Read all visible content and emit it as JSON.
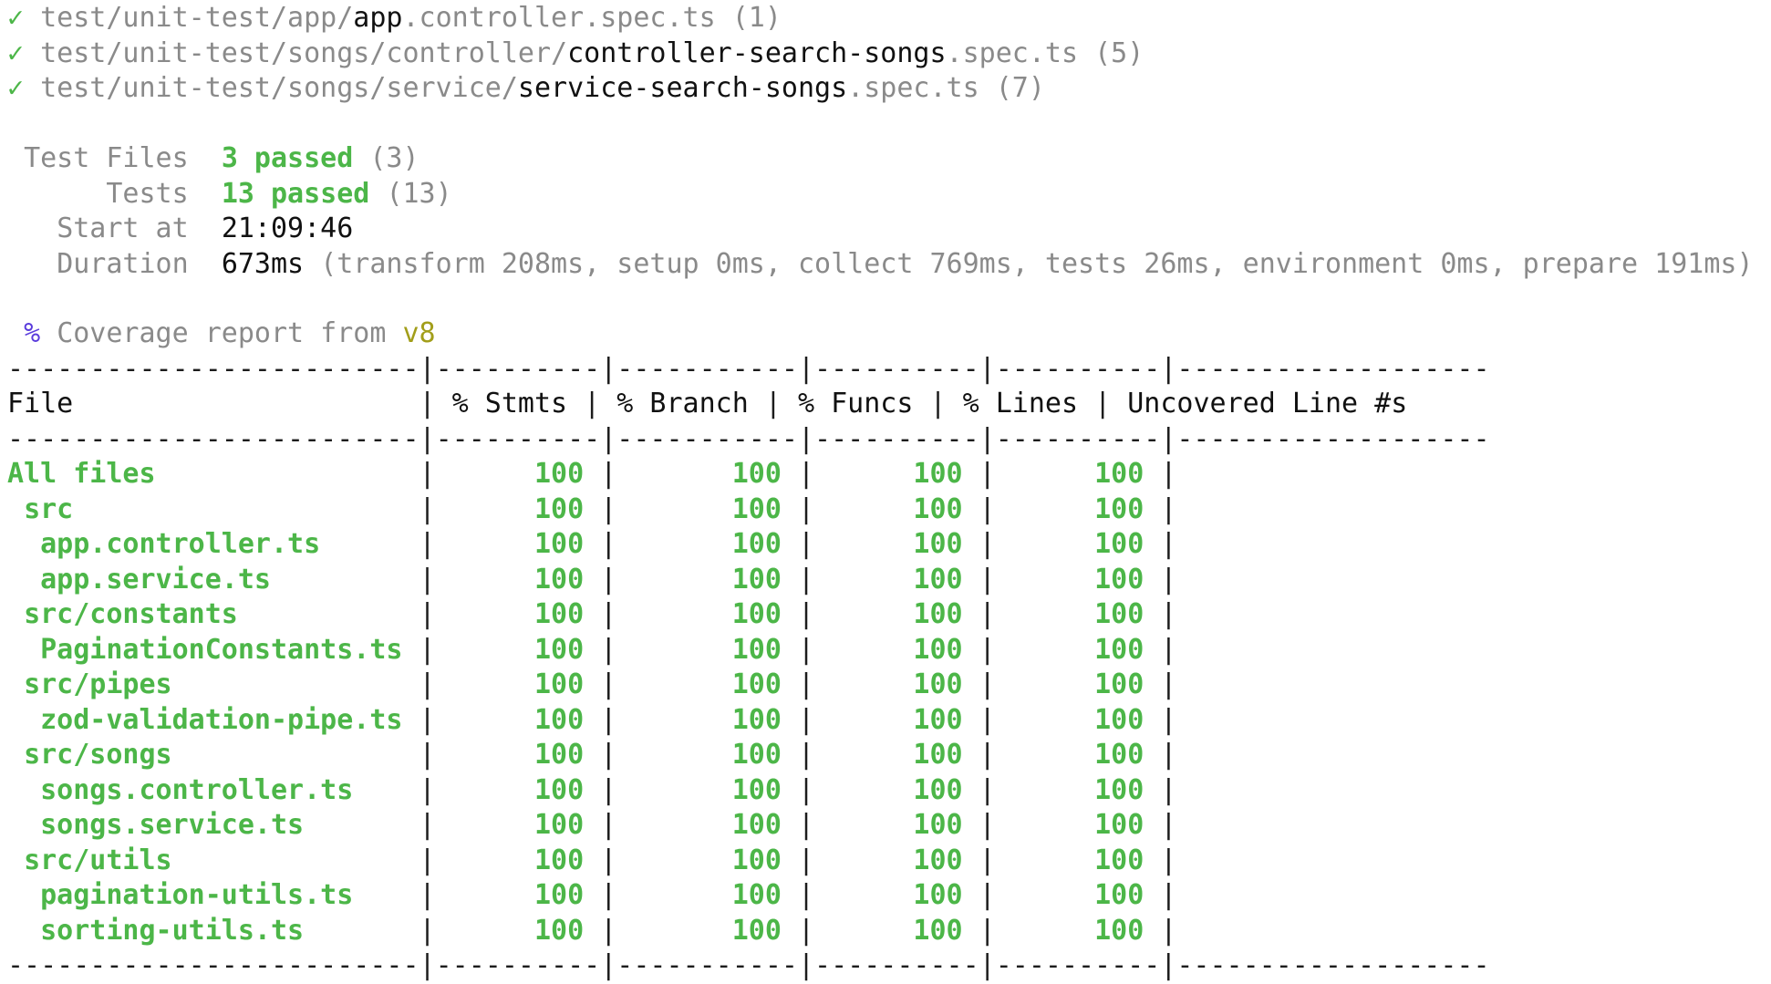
{
  "spec_files": [
    {
      "dir": "test/unit-test/app/",
      "name": "app",
      "ext": ".controller.spec.ts",
      "count": "(1)"
    },
    {
      "dir": "test/unit-test/songs/controller/",
      "name": "controller-search-songs",
      "ext": ".spec.ts",
      "count": "(5)"
    },
    {
      "dir": "test/unit-test/songs/service/",
      "name": "service-search-songs",
      "ext": ".spec.ts",
      "count": "(7)"
    }
  ],
  "summary": {
    "test_files": {
      "label": "Test Files",
      "passed": "3 passed",
      "total": "(3)"
    },
    "tests": {
      "label": "Tests",
      "passed": "13 passed",
      "total": "(13)"
    },
    "start_at": {
      "label": "Start at",
      "value": "21:09:46"
    },
    "duration": {
      "label": "Duration",
      "value": "673ms",
      "detail": "(transform 208ms, setup 0ms, collect 769ms, tests 26ms, environment 0ms, prepare 191ms)"
    }
  },
  "coverage": {
    "percent_sign": "%",
    "text": "Coverage report from",
    "provider": "v8"
  },
  "table": {
    "headers": [
      "File",
      "% Stmts",
      "% Branch",
      "% Funcs",
      "% Lines",
      "Uncovered Line #s"
    ],
    "rows": [
      {
        "file": "All files",
        "indent": 0,
        "stmts": "100",
        "branch": "100",
        "funcs": "100",
        "lines": "100",
        "uncovered": ""
      },
      {
        "file": "src",
        "indent": 1,
        "stmts": "100",
        "branch": "100",
        "funcs": "100",
        "lines": "100",
        "uncovered": ""
      },
      {
        "file": "app.controller.ts",
        "indent": 2,
        "stmts": "100",
        "branch": "100",
        "funcs": "100",
        "lines": "100",
        "uncovered": ""
      },
      {
        "file": "app.service.ts",
        "indent": 2,
        "stmts": "100",
        "branch": "100",
        "funcs": "100",
        "lines": "100",
        "uncovered": ""
      },
      {
        "file": "src/constants",
        "indent": 1,
        "stmts": "100",
        "branch": "100",
        "funcs": "100",
        "lines": "100",
        "uncovered": ""
      },
      {
        "file": "PaginationConstants.ts",
        "indent": 2,
        "stmts": "100",
        "branch": "100",
        "funcs": "100",
        "lines": "100",
        "uncovered": ""
      },
      {
        "file": "src/pipes",
        "indent": 1,
        "stmts": "100",
        "branch": "100",
        "funcs": "100",
        "lines": "100",
        "uncovered": ""
      },
      {
        "file": "zod-validation-pipe.ts",
        "indent": 2,
        "stmts": "100",
        "branch": "100",
        "funcs": "100",
        "lines": "100",
        "uncovered": ""
      },
      {
        "file": "src/songs",
        "indent": 1,
        "stmts": "100",
        "branch": "100",
        "funcs": "100",
        "lines": "100",
        "uncovered": ""
      },
      {
        "file": "songs.controller.ts",
        "indent": 2,
        "stmts": "100",
        "branch": "100",
        "funcs": "100",
        "lines": "100",
        "uncovered": ""
      },
      {
        "file": "songs.service.ts",
        "indent": 2,
        "stmts": "100",
        "branch": "100",
        "funcs": "100",
        "lines": "100",
        "uncovered": ""
      },
      {
        "file": "src/utils",
        "indent": 1,
        "stmts": "100",
        "branch": "100",
        "funcs": "100",
        "lines": "100",
        "uncovered": ""
      },
      {
        "file": "pagination-utils.ts",
        "indent": 2,
        "stmts": "100",
        "branch": "100",
        "funcs": "100",
        "lines": "100",
        "uncovered": ""
      },
      {
        "file": "sorting-utils.ts",
        "indent": 2,
        "stmts": "100",
        "branch": "100",
        "funcs": "100",
        "lines": "100",
        "uncovered": ""
      }
    ]
  },
  "colors": {
    "pass_green": "#4cb648",
    "dim_gray": "#8a8a8a",
    "percent_purple": "#5a3cdc",
    "provider_olive": "#a29e1a"
  }
}
